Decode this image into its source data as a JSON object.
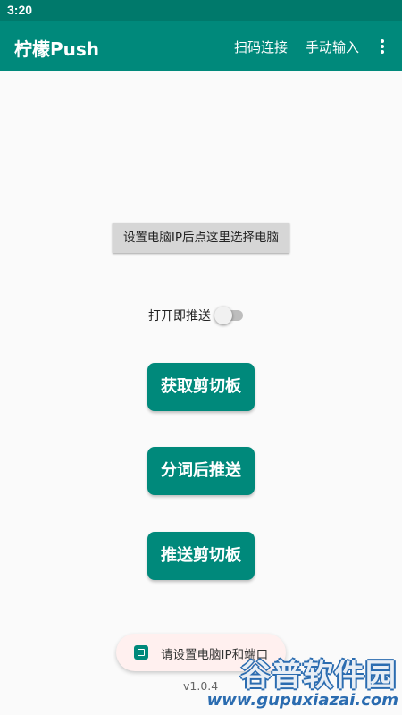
{
  "status_bar": {
    "time": "3:20"
  },
  "app_bar": {
    "title": "柠檬Push",
    "scan_connect": "扫码连接",
    "manual_input": "手动输入"
  },
  "main": {
    "select_computer": "设置电脑IP后点这里选择电脑",
    "switch_label": "打开即推送",
    "switch_on": false,
    "get_clipboard": "获取剪切板",
    "split_push": "分词后推送",
    "push_clipboard": "推送剪切板"
  },
  "toast": {
    "text": "请设置电脑IP和端口"
  },
  "version": "v1.0.4",
  "watermark": {
    "line1": "谷普软件园",
    "line2": "www.gupuxiazai.com"
  },
  "colors": {
    "primary": "#00897b",
    "status": "#00796b",
    "background": "#fafafa"
  }
}
